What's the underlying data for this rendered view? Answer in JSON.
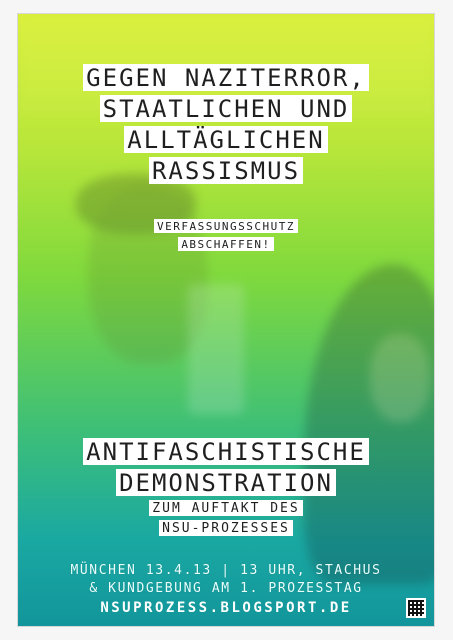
{
  "poster": {
    "headline": {
      "line1": "GEGEN NAZITERROR,",
      "line2": "STAATLICHEN UND",
      "line3": "ALLTÄGLICHEN",
      "line4": "RASSISMUS"
    },
    "subheadline": {
      "line1": "VERFASSUNGSSCHUTZ",
      "line2": "ABSCHAFFEN!"
    },
    "event": {
      "line1": "ANTIFASCHISTISCHE",
      "line2": "DEMONSTRATION",
      "line3": "ZUM AUFTAKT DES",
      "line4": "NSU-PROZESSES"
    },
    "details": {
      "line1": "MÜNCHEN 13.4.13 | 13 UHR, STACHUS",
      "line2": "& KUNDGEBUNG AM 1. PROZESSTAG"
    },
    "footer": {
      "website": "NSUPROZESS.BLOGSPORT.DE"
    }
  },
  "colors": {
    "top_green": "#d8ef38",
    "mid_green": "#7fd93d",
    "bottom_teal": "#12959b",
    "text_dark": "#1f1f1f",
    "text_light": "#ffffff"
  },
  "icons": {
    "qr": "qr-code-icon"
  }
}
